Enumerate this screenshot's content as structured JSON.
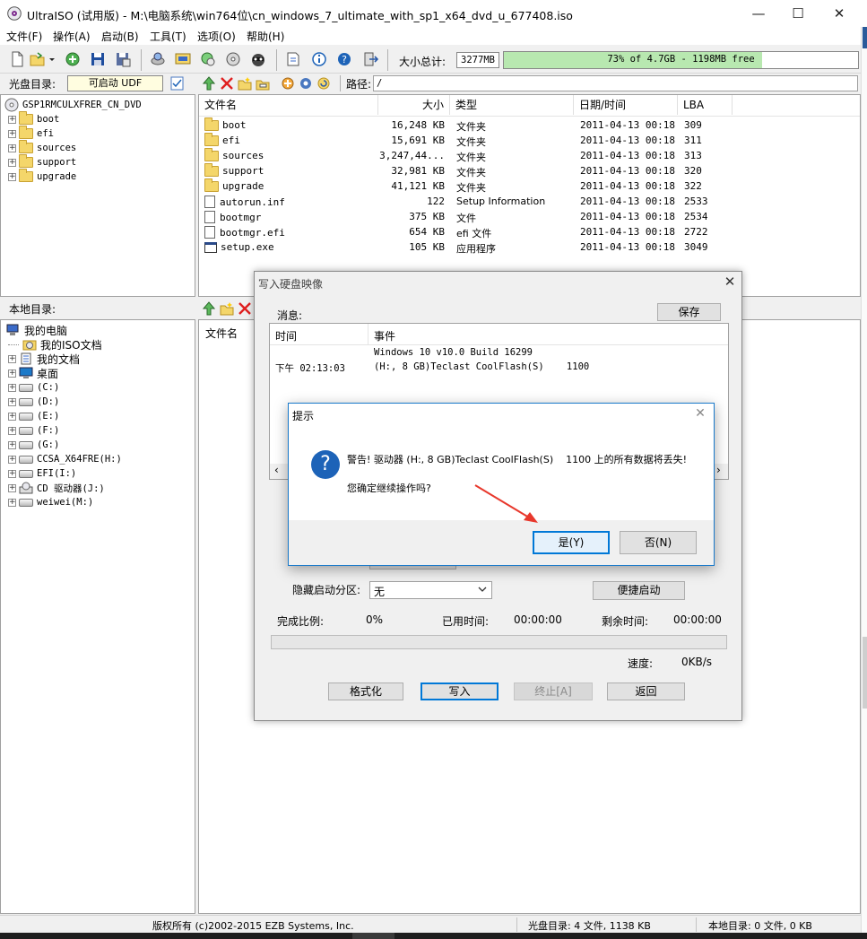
{
  "window": {
    "title": "UltraISO (试用版) - M:\\电脑系统\\win764位\\cn_windows_7_ultimate_with_sp1_x64_dvd_u_677408.iso",
    "minimize": "—",
    "maximize": "☐",
    "close": "✕"
  },
  "menu": [
    "文件(F)",
    "操作(A)",
    "启动(B)",
    "工具(T)",
    "选项(O)",
    "帮助(H)"
  ],
  "toolbar": {
    "total_label": "大小总计:",
    "total_value": "3277MB",
    "capacity_text": "73% of 4.7GB - 1198MB free",
    "capacity_used_percent": 73
  },
  "iso_pane": {
    "label": "光盘目录:",
    "boot_type": "可启动 UDF",
    "path_label": "路径:",
    "path": "/",
    "tree_root": "GSP1RMCULXFRER_CN_DVD",
    "tree": [
      "boot",
      "efi",
      "sources",
      "support",
      "upgrade"
    ],
    "columns": [
      "文件名",
      "大小",
      "类型",
      "日期/时间",
      "LBA"
    ],
    "files": [
      {
        "name": "boot",
        "size": "16,248 KB",
        "type": "文件夹",
        "date": "2011-04-13 00:18",
        "lba": "309",
        "icon": "folder"
      },
      {
        "name": "efi",
        "size": "15,691 KB",
        "type": "文件夹",
        "date": "2011-04-13 00:18",
        "lba": "311",
        "icon": "folder"
      },
      {
        "name": "sources",
        "size": "3,247,44...",
        "type": "文件夹",
        "date": "2011-04-13 00:18",
        "lba": "313",
        "icon": "folder"
      },
      {
        "name": "support",
        "size": "32,981 KB",
        "type": "文件夹",
        "date": "2011-04-13 00:18",
        "lba": "320",
        "icon": "folder"
      },
      {
        "name": "upgrade",
        "size": "41,121 KB",
        "type": "文件夹",
        "date": "2011-04-13 00:18",
        "lba": "322",
        "icon": "folder"
      },
      {
        "name": "autorun.inf",
        "size": "122",
        "type": "Setup Information",
        "date": "2011-04-13 00:18",
        "lba": "2533",
        "icon": "file"
      },
      {
        "name": "bootmgr",
        "size": "375 KB",
        "type": "文件",
        "date": "2011-04-13 00:18",
        "lba": "2534",
        "icon": "file"
      },
      {
        "name": "bootmgr.efi",
        "size": "654 KB",
        "type": "efi 文件",
        "date": "2011-04-13 00:18",
        "lba": "2722",
        "icon": "file"
      },
      {
        "name": "setup.exe",
        "size": "105 KB",
        "type": "应用程序",
        "date": "2011-04-13 00:18",
        "lba": "3049",
        "icon": "exe"
      }
    ]
  },
  "local_pane": {
    "label": "本地目录:",
    "col_name": "文件名",
    "tree": [
      {
        "label": "我的电脑",
        "icon": "computer",
        "level": 0
      },
      {
        "label": "我的ISO文档",
        "icon": "iso-folder",
        "level": 1
      },
      {
        "label": "我的文档",
        "icon": "documents",
        "level": 1
      },
      {
        "label": "桌面",
        "icon": "desktop",
        "level": 1
      },
      {
        "label": "(C:)",
        "icon": "drive",
        "level": 1
      },
      {
        "label": "(D:)",
        "icon": "drive",
        "level": 1
      },
      {
        "label": "(E:)",
        "icon": "drive",
        "level": 1
      },
      {
        "label": "(F:)",
        "icon": "drive",
        "level": 1
      },
      {
        "label": "(G:)",
        "icon": "drive",
        "level": 1
      },
      {
        "label": "CCSA_X64FRE(H:)",
        "icon": "drive",
        "level": 1
      },
      {
        "label": "EFI(I:)",
        "icon": "drive",
        "level": 1
      },
      {
        "label": "CD 驱动器(J:)",
        "icon": "cd-drive",
        "level": 1
      },
      {
        "label": "weiwei(M:)",
        "icon": "drive",
        "level": 1
      }
    ]
  },
  "status": {
    "copyright": "版权所有 (c)2002-2015 EZB Systems, Inc.",
    "iso_summary": "光盘目录: 4 文件, 1138 KB",
    "local_summary": "本地目录: 0 文件, 0 KB"
  },
  "write_dialog": {
    "title": "写入硬盘映像",
    "close": "✕",
    "messages_label": "消息:",
    "save": "保存",
    "col_time": "时间",
    "col_event": "事件",
    "log": [
      {
        "time": "",
        "event": "Windows 10 v10.0 Build 16299"
      },
      {
        "time": "下午 02:13:03",
        "event": "(H:, 8 GB)Teclast CoolFlash(S)    1100"
      }
    ],
    "hide_partition_label": "隐藏启动分区:",
    "hide_partition_value": "无",
    "quick_boot": "便捷启动",
    "progress_label": "完成比例:",
    "progress_value": "0%",
    "progress_percent": 0,
    "elapsed_label": "已用时间:",
    "elapsed_value": "00:00:00",
    "remaining_label": "剩余时间:",
    "remaining_value": "00:00:00",
    "speed_label": "速度:",
    "speed_value": "0KB/s",
    "buttons": {
      "format": "格式化",
      "write": "写入",
      "stop": "终止[A]",
      "back": "返回"
    }
  },
  "confirm_dialog": {
    "title": "提示",
    "close": "✕",
    "icon": "?",
    "warning": "警告! 驱动器 (H:, 8 GB)Teclast CoolFlash(S)    1100 上的所有数据将丢失!",
    "question": "您确定继续操作吗?",
    "yes": "是(Y)",
    "no": "否(N)"
  },
  "colors": {
    "accent": "#0078d7",
    "annotation_arrow": "#e8382c",
    "help_icon": "#1d63b8",
    "capacity_fill": "#b8e8b0"
  }
}
